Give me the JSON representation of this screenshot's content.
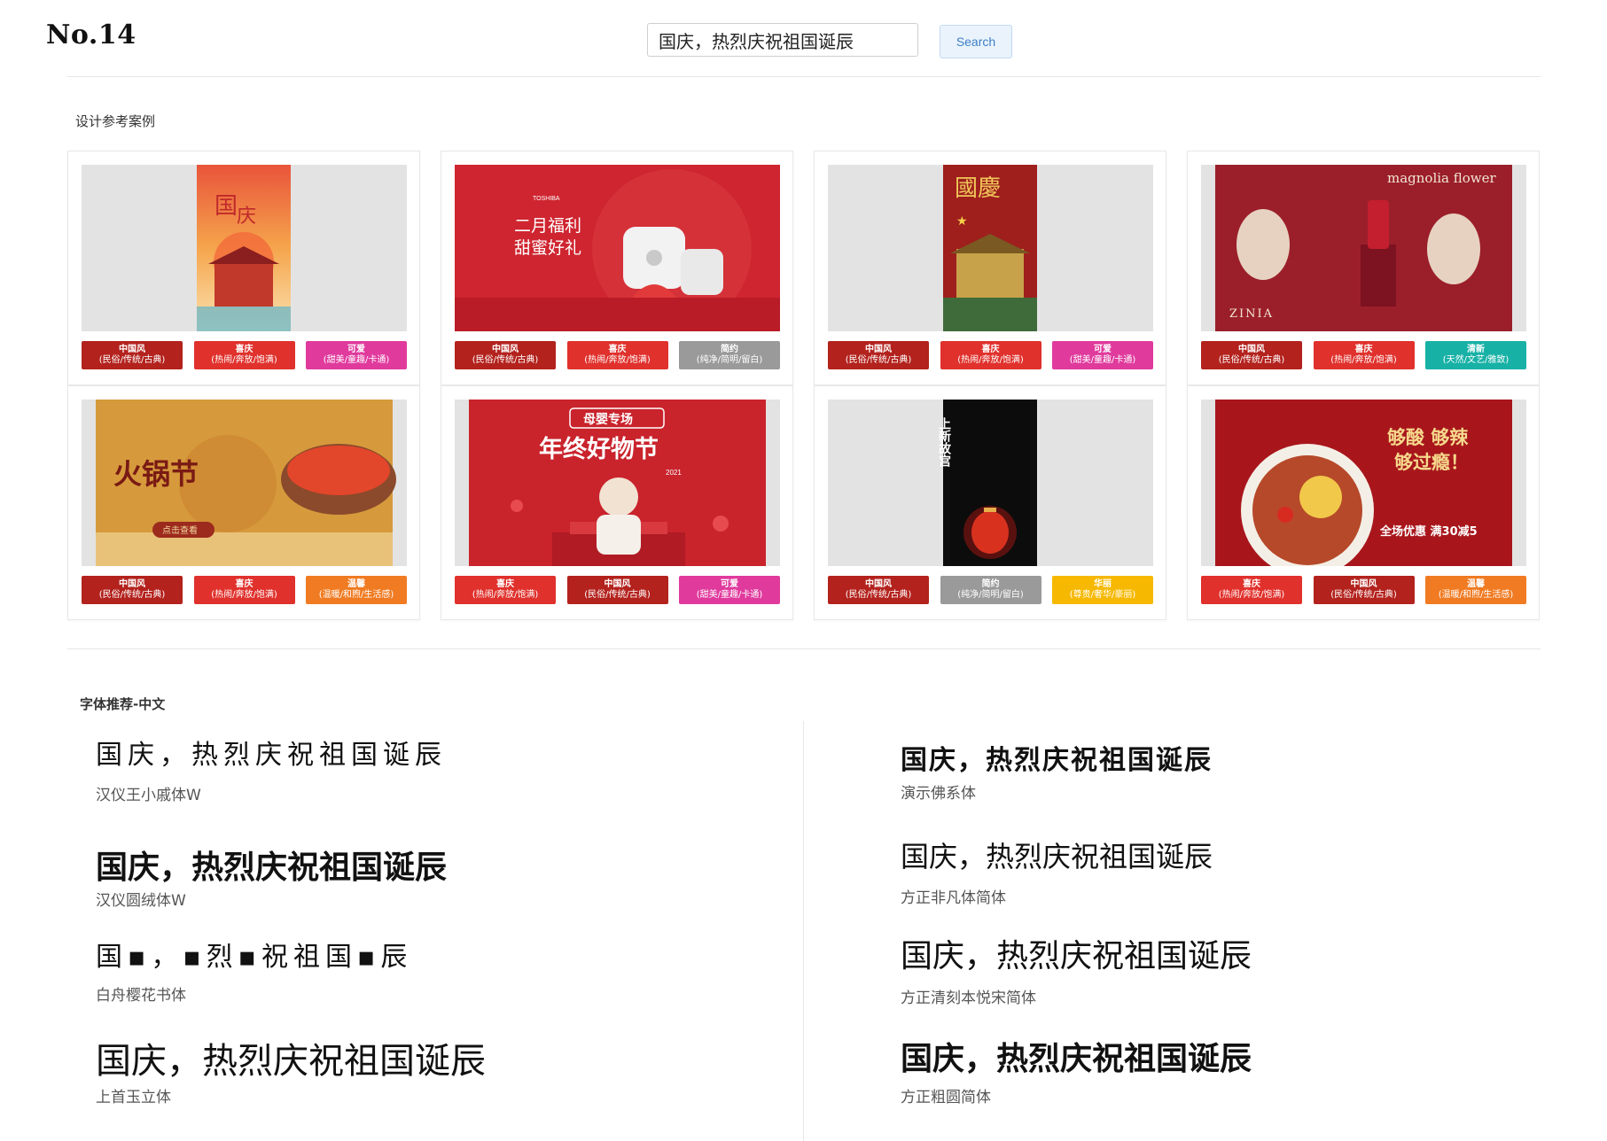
{
  "header": {
    "title": "No.14",
    "search_value": "国庆，热烈庆祝祖国诞辰",
    "search_button": "Search"
  },
  "cases": {
    "title": "设计参考案例",
    "items": [
      {
        "art": "poster-guoqing-vertical",
        "tags": [
          {
            "name": "中国风",
            "desc": "(民俗/传统/古典)",
            "color": "#b3221d"
          },
          {
            "name": "喜庆",
            "desc": "(热闹/奔放/饱满)",
            "color": "#e0312c"
          },
          {
            "name": "可爱",
            "desc": "(甜美/童趣/卡通)",
            "color": "#e03a9d"
          }
        ]
      },
      {
        "art": "banner-toshiba-rice-cooker",
        "banner_brand": "TOSHIBA",
        "banner_line1": "二月福利",
        "banner_line2": "甜蜜好礼",
        "tags": [
          {
            "name": "中国风",
            "desc": "(民俗/传统/古典)",
            "color": "#b3221d"
          },
          {
            "name": "喜庆",
            "desc": "(热闹/奔放/饱满)",
            "color": "#e0312c"
          },
          {
            "name": "简约",
            "desc": "(纯净/简明/留白)",
            "color": "#9a9a9a"
          }
        ]
      },
      {
        "art": "poster-guoqing-tiananmen",
        "poster_title": "國慶",
        "tags": [
          {
            "name": "中国风",
            "desc": "(民俗/传统/古典)",
            "color": "#b3221d"
          },
          {
            "name": "喜庆",
            "desc": "(热闹/奔放/饱满)",
            "color": "#e0312c"
          },
          {
            "name": "可爱",
            "desc": "(甜美/童趣/卡通)",
            "color": "#e03a9d"
          }
        ]
      },
      {
        "art": "banner-magnolia-lipstick",
        "banner_title": "magnolia flower",
        "banner_brand": "ZINIA",
        "tags": [
          {
            "name": "中国风",
            "desc": "(民俗/传统/古典)",
            "color": "#b3221d"
          },
          {
            "name": "喜庆",
            "desc": "(热闹/奔放/饱满)",
            "color": "#e0312c"
          },
          {
            "name": "清新",
            "desc": "(天然/文艺/雅致)",
            "color": "#18b1a6"
          }
        ]
      },
      {
        "art": "banner-hotpot-festival",
        "banner_title": "火锅节",
        "banner_button": "点击查看",
        "tags": [
          {
            "name": "中国风",
            "desc": "(民俗/传统/古典)",
            "color": "#b3221d"
          },
          {
            "name": "喜庆",
            "desc": "(热闹/奔放/饱满)",
            "color": "#e0312c"
          },
          {
            "name": "温馨",
            "desc": "(温暖/和煦/生活感)",
            "color": "#f07b22"
          }
        ]
      },
      {
        "art": "banner-year-end-sale",
        "banner_tag": "母婴专场",
        "banner_title": "年终好物节",
        "banner_year": "2021",
        "tags": [
          {
            "name": "喜庆",
            "desc": "(热闹/奔放/饱满)",
            "color": "#e0312c"
          },
          {
            "name": "中国风",
            "desc": "(民俗/传统/古典)",
            "color": "#b3221d"
          },
          {
            "name": "可爱",
            "desc": "(甜美/童趣/卡通)",
            "color": "#e03a9d"
          }
        ]
      },
      {
        "art": "poster-forbidden-city-lantern",
        "poster_title": "上新故宫",
        "tags": [
          {
            "name": "中国风",
            "desc": "(民俗/传统/古典)",
            "color": "#b3221d"
          },
          {
            "name": "简约",
            "desc": "(纯净/简明/留白)",
            "color": "#9a9a9a"
          },
          {
            "name": "华丽",
            "desc": "(尊贵/奢华/豪丽)",
            "color": "#f6b800"
          }
        ]
      },
      {
        "art": "banner-sour-spicy-noodles",
        "banner_line1": "够酸 够辣",
        "banner_line2": "够过瘾！",
        "banner_line3": "全场优惠 满30减5",
        "tags": [
          {
            "name": "喜庆",
            "desc": "(热闹/奔放/饱满)",
            "color": "#e0312c"
          },
          {
            "name": "中国风",
            "desc": "(民俗/传统/古典)",
            "color": "#b3221d"
          },
          {
            "name": "温馨",
            "desc": "(温暖/和煦/生活感)",
            "color": "#f07b22"
          }
        ]
      }
    ]
  },
  "fonts": {
    "title": "字体推荐-中文",
    "left": [
      {
        "sample": "国庆，热烈庆祝祖国诞辰",
        "name": "汉仪王小戚体W"
      },
      {
        "sample": "国庆，热烈庆祝祖国诞辰",
        "name": "汉仪圆绒体W"
      },
      {
        "sample": "国▪，▪烈▪祝祖国▪辰",
        "name": "白舟樱花书体"
      },
      {
        "sample": "国庆，热烈庆祝祖国诞辰",
        "name": "上首玉立体"
      }
    ],
    "right": [
      {
        "sample": "国庆，热烈庆祝祖国诞辰",
        "name": "演示佛系体"
      },
      {
        "sample": "国庆，热烈庆祝祖国诞辰",
        "name": "方正非凡体简体"
      },
      {
        "sample": "国庆，热烈庆祝祖国诞辰",
        "name": "方正清刻本悦宋简体"
      },
      {
        "sample": "国庆，热烈庆祝祖国诞辰",
        "name": "方正粗圆简体"
      }
    ]
  }
}
